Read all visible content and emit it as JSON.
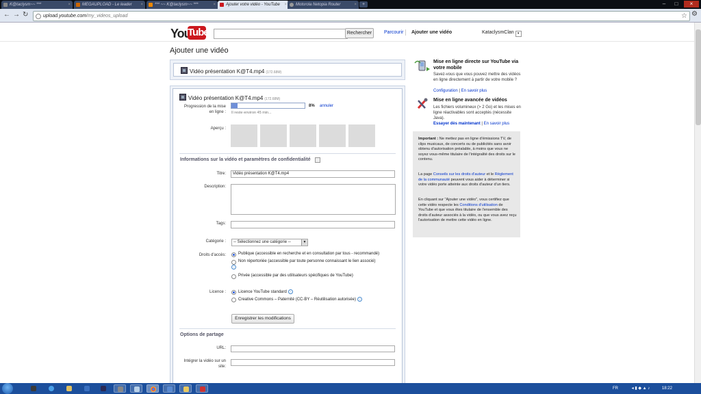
{
  "browser": {
    "tabs": [
      {
        "label": "K@taclysm~~ ***",
        "active": false
      },
      {
        "label": "MEGAUPLOAD - Le leader",
        "active": false
      },
      {
        "label": "*** ~~ K@taclysm~~ ***",
        "active": false
      },
      {
        "label": "Ajouter votre vidéo - YouTube",
        "active": true
      },
      {
        "label": "Motorola Netopia Router",
        "active": false
      }
    ],
    "new_tab": "+",
    "url_host": "upload.youtube.com",
    "url_path": "/my_videos_upload",
    "back": "←",
    "forward": "→",
    "reload": "↻",
    "star": "☆",
    "wrench": "⚙"
  },
  "header": {
    "logo_you": "You",
    "logo_tube": "Tube",
    "search_placeholder": "",
    "search_button": "Rechercher",
    "browse_link": "Parcourir",
    "upload_link": "Ajouter une vidéo",
    "username": "KataclysmClan",
    "user_dropdown": "▾"
  },
  "page": {
    "title": "Ajouter une vidéo"
  },
  "upload_top": {
    "filename": "Vidéo présentation K@T4.mp4",
    "filesize": "(172.68M)"
  },
  "upload_main": {
    "filename": "Vidéo présentation K@T4.mp4",
    "filesize": "(172.68M)",
    "progress_label": "Progression de la mise en ligne :",
    "progress_percent_text": "8%",
    "progress_fraction": 0.08,
    "cancel_link": "annuler",
    "time_left": "Il reste environ 45 min...",
    "preview_label": "Aperçu :",
    "info_section_title": "Informations sur la vidéo et paramètres de confidentialité",
    "title_label": "Titre:",
    "title_value": "Vidéo présentation K@T4.mp4",
    "description_label": "Description:",
    "description_value": "",
    "tags_label": "Tags:",
    "tags_value": "",
    "category_label": "Catégorie :",
    "category_value": "-- Sélectionnez une catégorie --",
    "access_label": "Droits d'accès:",
    "access_options": [
      {
        "label": "Publique (accessible en recherche et en consultation par tous - recommandé)",
        "selected": true
      },
      {
        "label": "Non répertoriée (accessible par toute personne connaissant le lien associé)",
        "selected": false
      },
      {
        "label": "Privée (accessible par des utilisateurs spécifiques de YouTube)",
        "selected": false
      }
    ],
    "license_label": "Licence :",
    "license_options": [
      {
        "label": "Licence YouTube standard",
        "selected": true
      },
      {
        "label": "Creative Commons – Paternité (CC-BY – Réutilisation autorisée)",
        "selected": false
      }
    ],
    "save_button": "Enregistrer les modifications",
    "share_section_title": "Options de partage",
    "url_label": "URL:",
    "url_value": "",
    "embed_label": "Intégrer la vidéo sur un site:",
    "embed_value": ""
  },
  "sidebar": {
    "mobile_title": "Mise en ligne directe sur YouTube via votre mobile",
    "mobile_text": "Savez-vous que vous pouvez mettre des vidéos en ligne directement à partir de votre mobile ?",
    "mobile_link1": "Configuration",
    "mobile_link2": "En savoir plus",
    "advanced_title": "Mise en ligne avancée de vidéos",
    "advanced_text": "Les fichiers volumineux (> 2 Go) et les mises en ligne réactivables sont acceptés (nécessite Java).",
    "advanced_link1": "Essayer dès maintenant",
    "advanced_link2": "En savoir plus",
    "separator": "|",
    "notice_p1_bold": "Important :",
    "notice_p1": " Ne mettez pas en ligne d'émissions TV, de clips musicaux, de concerts ou de publicités sans avoir obtenu d'autorisation préalable, à moins que vous ne soyez vous-même titulaire de l'intégralité des droits sur le contenu.",
    "notice_p2_a": "La page ",
    "notice_p2_link1": "Conseils sur les droits d'auteur",
    "notice_p2_b": " et le ",
    "notice_p2_link2": "Règlement de la communauté",
    "notice_p2_c": " peuvent vous aider à déterminer si votre vidéo porte atteinte aux droits d'auteur d'un tiers.",
    "notice_p3_a": "En cliquant sur \"Ajouter une vidéo\", vous certifiez que cette vidéo respecte les ",
    "notice_p3_link": "Conditions d'utilisation",
    "notice_p3_b": " de YouTube et que vous êtes titulaire de l'ensemble des droits d'auteur associés à la vidéo, ou que vous avez reçu l'autorisation de mettre cette vidéo en ligne."
  },
  "taskbar": {
    "lang": "FR",
    "clock": "18:22"
  },
  "colors": {
    "yt_red": "#cc181e",
    "link_blue": "#0033cc",
    "progress_blue": "#6f8fd8",
    "taskbar": "#1c4f9c"
  }
}
